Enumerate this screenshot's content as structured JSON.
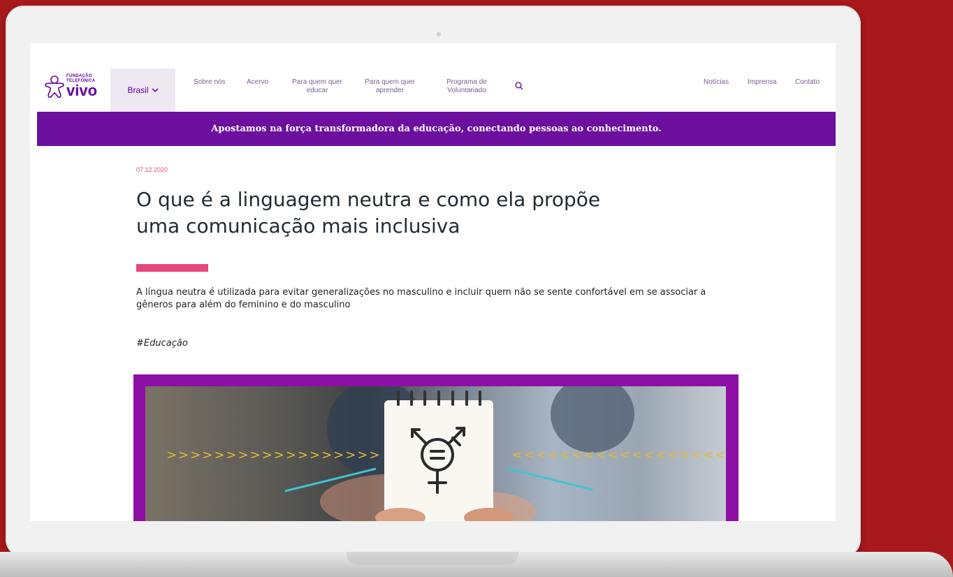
{
  "site": {
    "logo": {
      "line1": "FUNDAÇÃO",
      "line2": "TELEFÔNICA",
      "brand": "vivo"
    },
    "country_selector": "Brasil",
    "nav": [
      {
        "label": "Sobre nós"
      },
      {
        "label": "Acervo"
      },
      {
        "label": "Para quem quer educar"
      },
      {
        "label": "Para quem quer aprender"
      },
      {
        "label": "Programa de Voluntariado"
      }
    ],
    "secondary_nav": [
      {
        "label": "Notícias"
      },
      {
        "label": "Imprensa"
      },
      {
        "label": "Contato"
      }
    ],
    "banner": "Apostamos na força transformadora da educação, conectando pessoas ao conhecimento."
  },
  "article": {
    "date": "07.12.2020",
    "title_line1": "O que é a linguagem neutra e como ela propõe",
    "title_line2": "uma comunicação mais inclusiva",
    "summary": "A língua neutra é utilizada para evitar generalizações no masculino e incluir quem não se sente confortável em se associar a gêneros para além do feminino e do masculino",
    "tag": "#Educação",
    "hero_left_arrows": ">>>>>>>>>>>>>>>>>>",
    "hero_right_arrows": "<<<<<<<<<<<<<<<<<<"
  },
  "colors": {
    "page_background": "#a7191b",
    "brand_purple": "#660099",
    "banner": "#6c0f9f",
    "accent_pink": "#e8467f",
    "hero_frame": "#8e0fa5"
  },
  "icons": [
    "search-icon",
    "chevron-down-icon",
    "transgender-symbol-icon"
  ]
}
